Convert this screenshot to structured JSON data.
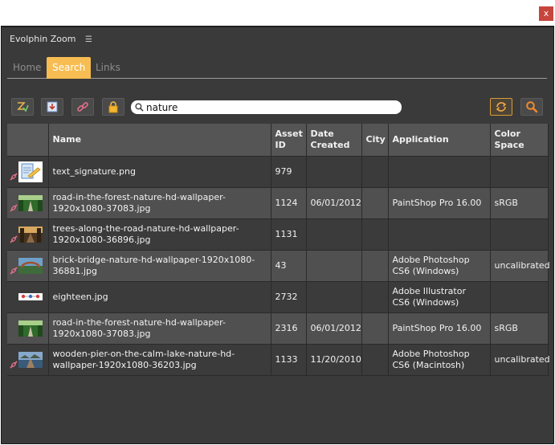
{
  "window": {
    "close_glyph": "x"
  },
  "panel": {
    "title": "Evolphin Zoom",
    "menu_icon": "hamburger-icon"
  },
  "tabs": [
    {
      "label": "Home",
      "active": false
    },
    {
      "label": "Search",
      "active": true
    },
    {
      "label": "Links",
      "active": false
    }
  ],
  "toolbar": {
    "buttons": [
      "checkin-icon",
      "import-icon",
      "link-icon",
      "lock-icon"
    ],
    "search": {
      "value": "nature",
      "placeholder": ""
    },
    "refresh_icon": "refresh-icon",
    "search_go_icon": "search-icon"
  },
  "colors": {
    "accent": "#f7bd53",
    "panel_bg": "#3a3a3a",
    "link_marker": "#e0708a"
  },
  "table": {
    "columns": [
      "",
      "Name",
      "Asset ID",
      "Date Created",
      "City",
      "Application",
      "Color Space"
    ],
    "rows": [
      {
        "linked": true,
        "thumb": "document-signature",
        "name": "text_signature.png",
        "asset_id": "979",
        "date": "",
        "city": "",
        "application": "",
        "color_space": ""
      },
      {
        "linked": true,
        "thumb": "forest-road",
        "name": "road-in-the-forest-nature-hd-wallpaper-1920x1080-37083.jpg",
        "asset_id": "1124",
        "date": "06/01/2012",
        "city": "",
        "application": "PaintShop Pro 16.00",
        "color_space": "sRGB"
      },
      {
        "linked": true,
        "thumb": "trees-road",
        "name": "trees-along-the-road-nature-hd-wallpaper-1920x1080-36896.jpg",
        "asset_id": "1131",
        "date": "",
        "city": "",
        "application": "",
        "color_space": ""
      },
      {
        "linked": true,
        "thumb": "brick-bridge",
        "name": "brick-bridge-nature-hd-wallpaper-1920x1080-36881.jpg",
        "asset_id": "43",
        "date": "",
        "city": "",
        "application": "Adobe Photoshop CS6 (Windows)",
        "color_space": "uncalibrated"
      },
      {
        "linked": false,
        "thumb": "illustration",
        "name": "eighteen.jpg",
        "asset_id": "2732",
        "date": "",
        "city": "",
        "application": "Adobe Illustrator CS6 (Windows)",
        "color_space": ""
      },
      {
        "linked": false,
        "thumb": "forest-road",
        "name": "road-in-the-forest-nature-hd-wallpaper-1920x1080-37083.jpg",
        "asset_id": "2316",
        "date": "06/01/2012",
        "city": "",
        "application": "PaintShop Pro 16.00",
        "color_space": "sRGB"
      },
      {
        "linked": true,
        "thumb": "lake-pier",
        "name": "wooden-pier-on-the-calm-lake-nature-hd-wallpaper-1920x1080-36203.jpg",
        "asset_id": "1133",
        "date": "11/20/2010",
        "city": "",
        "application": "Adobe Photoshop CS6 (Macintosh)",
        "color_space": "uncalibrated"
      }
    ]
  }
}
